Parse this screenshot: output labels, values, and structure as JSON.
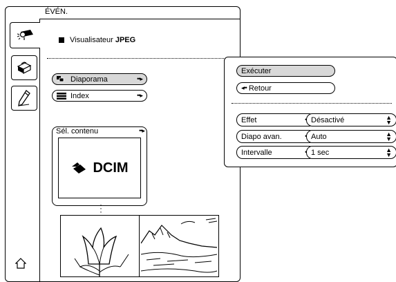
{
  "window": {
    "title": "ÉVÉN."
  },
  "section": {
    "title_prefix": "Visualisateur ",
    "title_bold": "JPEG"
  },
  "menu": {
    "diaporama": "Diaporama",
    "index": "Index"
  },
  "content": {
    "label": "Sél. contenu",
    "folder": "DCIM"
  },
  "popup": {
    "execute": "Exécuter",
    "back": "Retour",
    "rows": [
      {
        "label": "Effet",
        "value": "Désactivé"
      },
      {
        "label": "Diapo avan.",
        "value": "Auto"
      },
      {
        "label": "Intervalle",
        "value": "1 sec"
      }
    ]
  },
  "icons": {
    "tab1": "projector-icon",
    "tab2": "toolbox-icon",
    "tab3": "pen-icon",
    "home": "home-icon",
    "folder": "folder-icon"
  }
}
